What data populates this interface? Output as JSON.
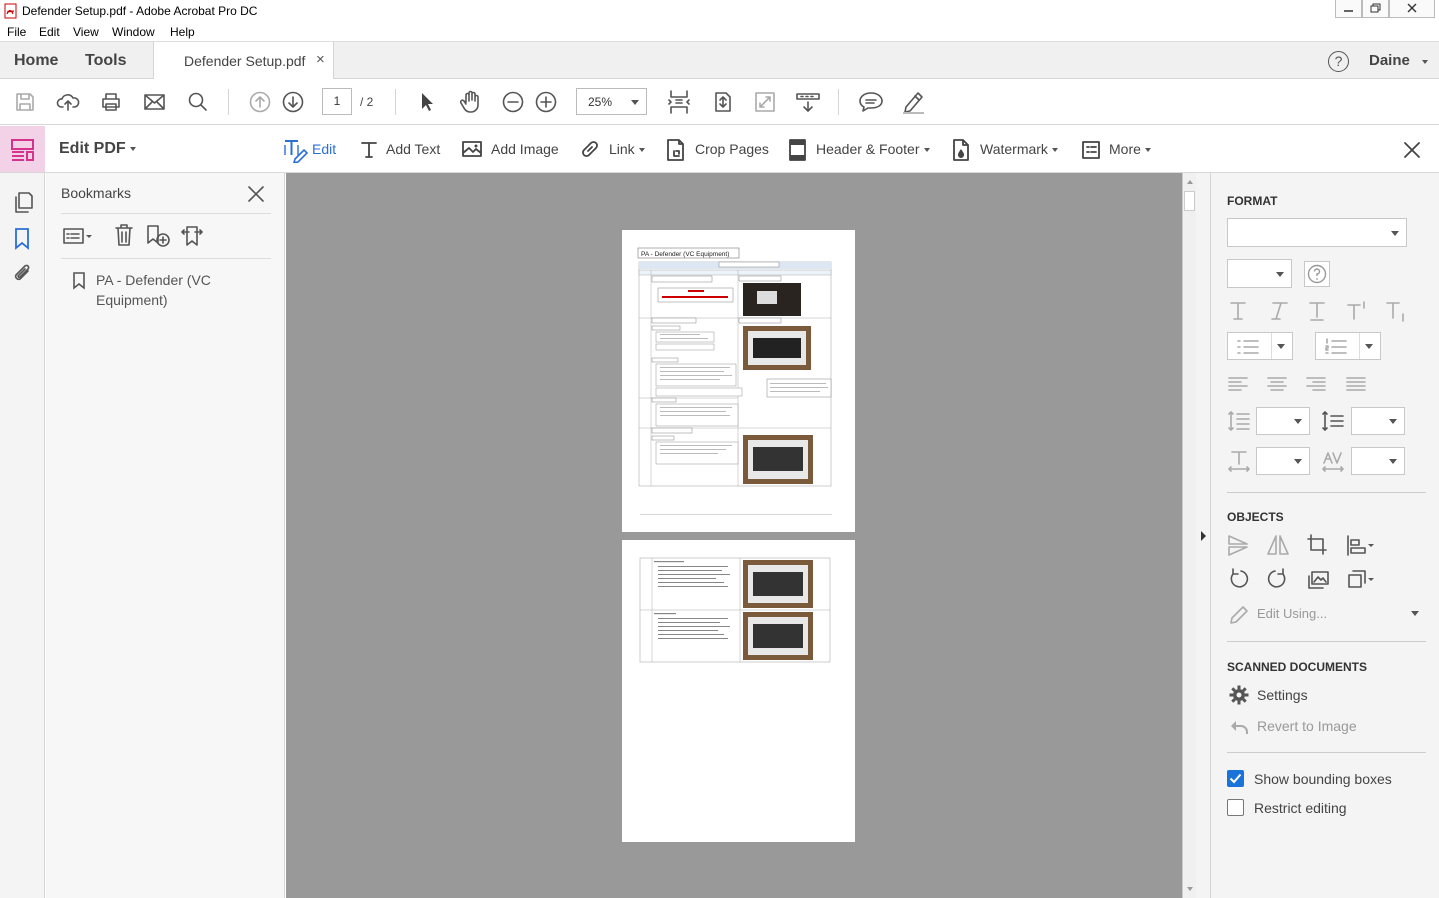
{
  "window": {
    "title": "Defender Setup.pdf - Adobe Acrobat Pro DC",
    "controls": [
      "minimize",
      "restore",
      "close"
    ]
  },
  "menu": [
    "File",
    "Edit",
    "View",
    "Window",
    "Help"
  ],
  "tabs": {
    "home": "Home",
    "tools": "Tools",
    "document": "Defender Setup.pdf",
    "close_glyph": "×",
    "help_glyph": "?",
    "user": "Daine"
  },
  "toolbar": {
    "page_current": "1",
    "page_total": "/ 2",
    "zoom": "25%"
  },
  "editbar": {
    "title": "Edit PDF",
    "tools": [
      {
        "label": "Edit",
        "icon": "edit-text-icon",
        "active": true
      },
      {
        "label": "Add Text",
        "icon": "add-text-icon"
      },
      {
        "label": "Add Image",
        "icon": "add-image-icon"
      },
      {
        "label": "Link",
        "icon": "link-icon",
        "dropdown": true
      },
      {
        "label": "Crop Pages",
        "icon": "crop-pages-icon"
      },
      {
        "label": "Header & Footer",
        "icon": "header-footer-icon",
        "dropdown": true
      },
      {
        "label": "Watermark",
        "icon": "watermark-icon",
        "dropdown": true
      },
      {
        "label": "More",
        "icon": "more-icon",
        "dropdown": true
      }
    ],
    "accent": "#2a6fd6"
  },
  "bookmarks": {
    "title": "Bookmarks",
    "items": [
      {
        "label": "PA - Defender (VC Equipment)"
      }
    ]
  },
  "document": {
    "page1_title": "PA - Defender (VC Equipment)"
  },
  "format_panel": {
    "format_heading": "FORMAT",
    "objects_heading": "OBJECTS",
    "edit_using": "Edit Using...",
    "scanned_heading": "SCANNED DOCUMENTS",
    "settings": "Settings",
    "revert": "Revert to Image",
    "show_bounding_boxes": {
      "label": "Show bounding boxes",
      "checked": true
    },
    "restrict_editing": {
      "label": "Restrict editing",
      "checked": false
    }
  },
  "colors": {
    "edit_pdf_accent": "#d6338f",
    "checkbox_blue": "#1a73d9",
    "doc_background": "#999999"
  }
}
